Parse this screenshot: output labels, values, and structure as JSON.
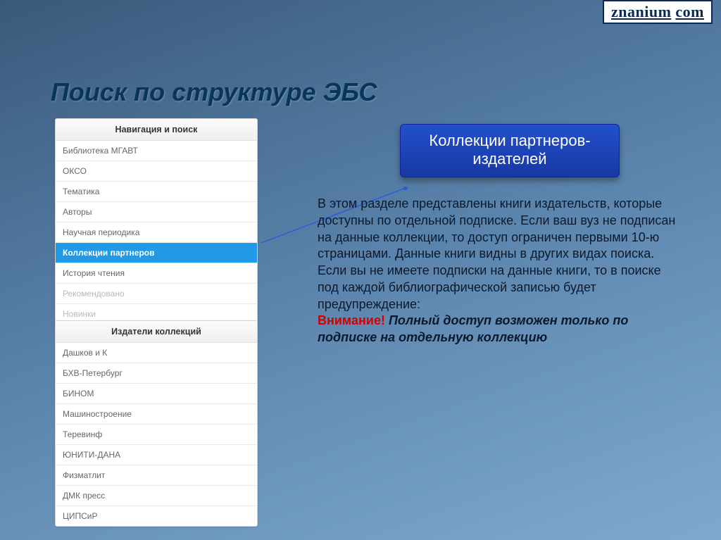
{
  "logo": {
    "text_a": "znanium",
    "text_b": "com"
  },
  "title": "Поиск по структуре ЭБС",
  "nav": {
    "header": "Навигация и поиск",
    "items": [
      {
        "label": "Библиотека МГАВТ",
        "cls": ""
      },
      {
        "label": "ОКСО",
        "cls": ""
      },
      {
        "label": "Тематика",
        "cls": ""
      },
      {
        "label": "Авторы",
        "cls": ""
      },
      {
        "label": "Научная периодика",
        "cls": ""
      },
      {
        "label": "Коллекции партнеров",
        "cls": "selected"
      },
      {
        "label": "История чтения",
        "cls": ""
      },
      {
        "label": "Рекомендовано",
        "cls": "muted"
      },
      {
        "label": "Новинки",
        "cls": "muted"
      }
    ]
  },
  "publishers": {
    "header": "Издатели коллекций",
    "items": [
      {
        "label": "Дашков и К"
      },
      {
        "label": "БХВ-Петербург"
      },
      {
        "label": "БИНОМ"
      },
      {
        "label": "Машиностроение"
      },
      {
        "label": "Теревинф"
      },
      {
        "label": "ЮНИТИ-ДАНА"
      },
      {
        "label": "Физматлит"
      },
      {
        "label": "ДМК пресс"
      },
      {
        "label": "ЦИПСиР"
      }
    ]
  },
  "badge": "Коллекции партнеров-издателей",
  "description": {
    "body": "В этом разделе представлены книги издательств, которые доступны по отдельной подписке. Если ваш вуз не подписан на данные коллекции, то доступ ограничен первыми 10-ю страницами. Данные книги видны в других видах поиска. Если вы не имеете подписки на данные книги, то в поиске под каждой библиографической записью будет предупреждение:",
    "warn": "Внимание!",
    "emph": " Полный доступ возможен только по подписке на отдельную коллекцию"
  }
}
